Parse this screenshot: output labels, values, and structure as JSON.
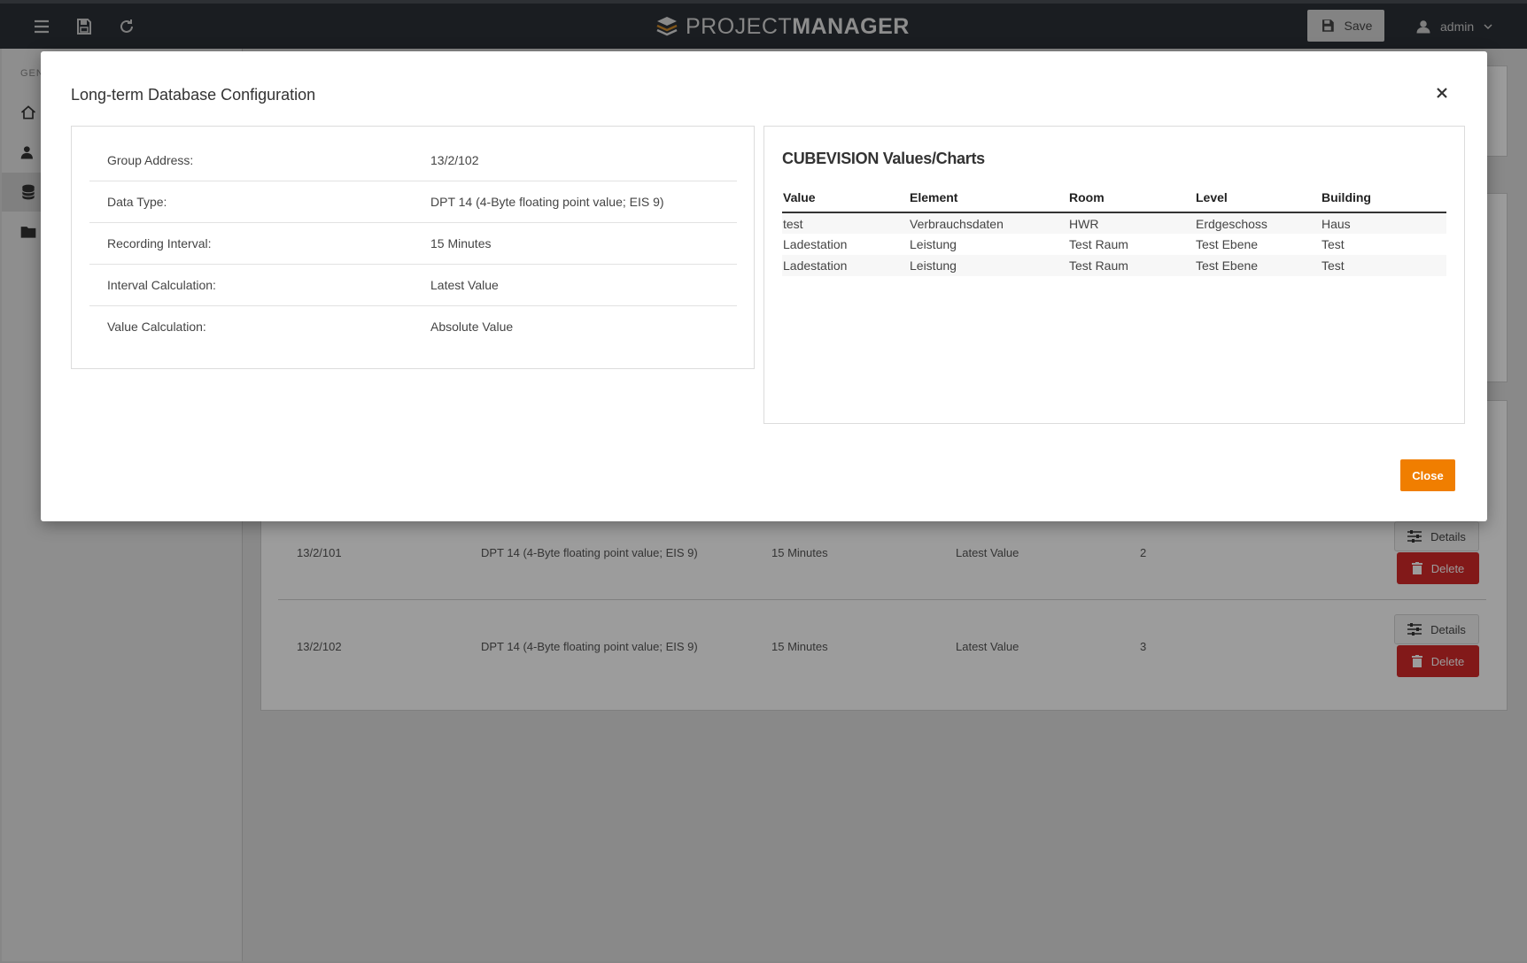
{
  "topbar": {
    "logo_light": "PROJECT",
    "logo_bold": "MANAGER",
    "save_label": "Save",
    "user_name": "admin"
  },
  "sidebar": {
    "section_label": "GEN"
  },
  "background_rows": [
    {
      "address": "13/2/101",
      "type": "DPT 14 (4-Byte floating point value; EIS 9)",
      "interval": "15 Minutes",
      "calc": "Latest Value",
      "count": "2"
    },
    {
      "address": "13/2/102",
      "type": "DPT 14 (4-Byte floating point value; EIS 9)",
      "interval": "15 Minutes",
      "calc": "Latest Value",
      "count": "3"
    }
  ],
  "row_buttons": {
    "details": "Details",
    "delete": "Delete"
  },
  "modal": {
    "title": "Long-term Database Configuration",
    "config": [
      {
        "label": "Group Address:",
        "value": "13/2/102"
      },
      {
        "label": "Data Type:",
        "value": "DPT 14 (4-Byte floating point value; EIS 9)"
      },
      {
        "label": "Recording Interval:",
        "value": "15 Minutes"
      },
      {
        "label": "Interval Calculation:",
        "value": "Latest Value"
      },
      {
        "label": "Value Calculation:",
        "value": "Absolute Value"
      }
    ],
    "cubevision": {
      "title": "CUBEVISION Values/Charts",
      "headers": [
        "Value",
        "Element",
        "Room",
        "Level",
        "Building"
      ],
      "rows": [
        [
          "test",
          "Verbrauchsdaten",
          "HWR",
          "Erdgeschoss",
          "Haus"
        ],
        [
          "Ladestation",
          "Leistung",
          "Test Raum",
          "Test Ebene",
          "Test"
        ],
        [
          "Ladestation",
          "Leistung",
          "Test Raum",
          "Test Ebene",
          "Test"
        ]
      ]
    },
    "close_label": "Close"
  },
  "colors": {
    "accent": "#f07e00",
    "danger": "#d42a2a",
    "topbar": "#2b3036"
  }
}
